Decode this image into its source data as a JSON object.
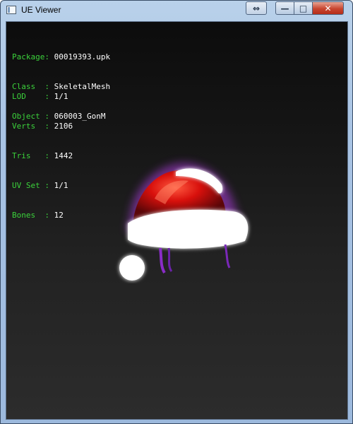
{
  "window": {
    "title": "UE Viewer",
    "buttons": {
      "resize_icon": "⇔",
      "minimize_icon": "—",
      "maximize_icon": "□",
      "close_icon": "✕"
    }
  },
  "info_block_1": [
    {
      "label": "Package: ",
      "value": "00019393.upk"
    },
    {
      "label": "Class  : ",
      "value": "SkeletalMesh"
    },
    {
      "label": "Object : ",
      "value": "060003_GonM"
    }
  ],
  "info_block_2": [
    {
      "label": "LOD    : ",
      "value": "1/1"
    },
    {
      "label": "Verts  : ",
      "value": "2106"
    },
    {
      "label": "Tris   : ",
      "value": "1442"
    },
    {
      "label": "UV Set : ",
      "value": "1/1"
    },
    {
      "label": "Bones  : ",
      "value": "12"
    }
  ],
  "colors": {
    "label_green": "#3bd23b",
    "value_white": "#ffffff",
    "hat_red": "#d8100c",
    "fur_white": "#ffffff",
    "glow_purple": "#b03ce0"
  },
  "viewport": {
    "model_icon": "santa-hat-mesh"
  }
}
